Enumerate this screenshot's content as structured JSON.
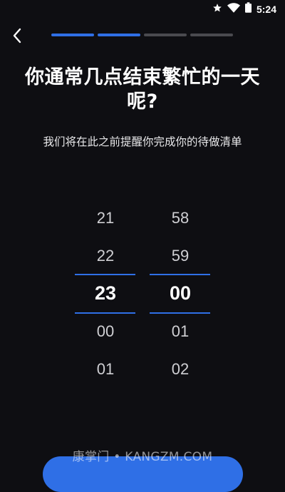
{
  "status_bar": {
    "time": "5:24",
    "icons": [
      "star-icon",
      "wifi-icon",
      "battery-icon"
    ]
  },
  "progress": {
    "total_steps": 4,
    "current_step": 2
  },
  "question": {
    "title": "你通常几点结束繁忙的一天呢?",
    "subtitle": "我们将在此之前提醒你完成你的待做清单"
  },
  "time_picker": {
    "hours": [
      "21",
      "22",
      "23",
      "00",
      "01"
    ],
    "minutes": [
      "58",
      "59",
      "00",
      "01",
      "02"
    ],
    "selected_hour": "23",
    "selected_minute": "00"
  },
  "watermark": "康掌门 • KANGZM.COM",
  "colors": {
    "background": "#0e0e12",
    "accent": "#2f6fe6",
    "inactive_segment": "#4a4a4f"
  }
}
